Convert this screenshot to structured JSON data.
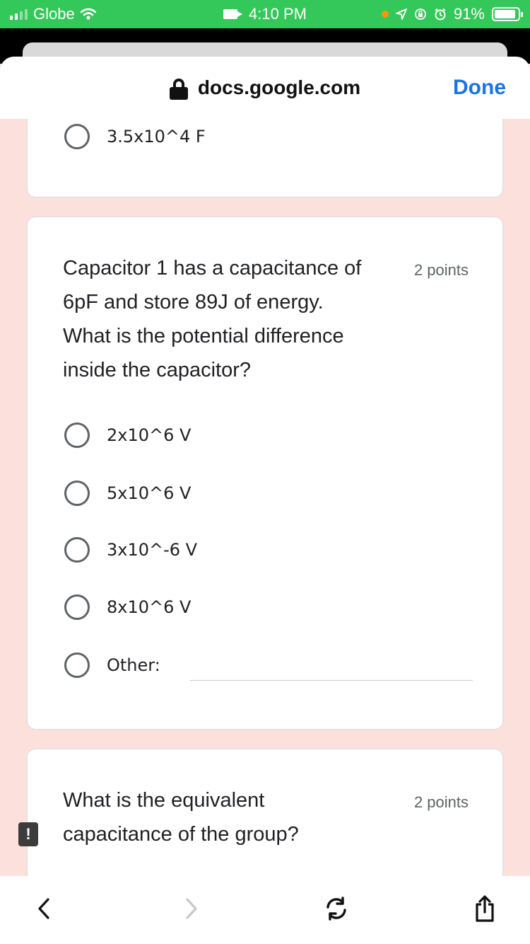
{
  "status_bar": {
    "carrier": "Globe",
    "time": "4:10 PM",
    "battery": "91%",
    "battery_level": 0.91,
    "color": "#34c759"
  },
  "browser": {
    "url": "docs.google.com",
    "done_label": "Done",
    "accent": "#1a73e8"
  },
  "previous_card": {
    "option": "3.5x10^4 F"
  },
  "question_card": {
    "line1": "Capacitor 1 has a capacitance of",
    "line2": "6pF and store 89J of energy.",
    "line3": "What is the potential difference",
    "line4": "inside the capacitor?",
    "points": "2 points",
    "options": [
      "2x10^6 V",
      "5x10^6 V",
      "3x10^-6 V",
      "8x10^6 V"
    ],
    "other_label": "Other:"
  },
  "next_card": {
    "line1": "What is the equivalent",
    "line2": "capacitance of the group?",
    "points": "2 points",
    "warning_glyph": "!"
  },
  "toolbar": {
    "icons": [
      "chevron-left-icon",
      "chevron-right-icon",
      "refresh-icon",
      "share-icon"
    ]
  }
}
